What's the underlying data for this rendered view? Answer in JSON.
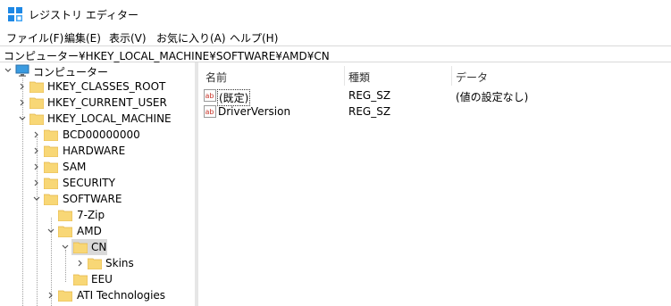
{
  "window": {
    "title": "レジストリ エディター"
  },
  "menu": [
    "ファイル(F)",
    "編集(E)",
    "表示(V)",
    "お気に入り(A)",
    "ヘルプ(H)"
  ],
  "address": "コンピューター¥HKEY_LOCAL_MACHINE¥SOFTWARE¥AMD¥CN",
  "tree": {
    "root": "コンピューター",
    "nodes": [
      {
        "label": "HKEY_CLASSES_ROOT"
      },
      {
        "label": "HKEY_CURRENT_USER"
      },
      {
        "label": "HKEY_LOCAL_MACHINE"
      },
      {
        "label": "BCD00000000"
      },
      {
        "label": "HARDWARE"
      },
      {
        "label": "SAM"
      },
      {
        "label": "SECURITY"
      },
      {
        "label": "SOFTWARE"
      },
      {
        "label": "7-Zip"
      },
      {
        "label": "AMD"
      },
      {
        "label": "CN"
      },
      {
        "label": "Skins"
      },
      {
        "label": "EEU"
      },
      {
        "label": "ATI Technologies"
      }
    ]
  },
  "list": {
    "columns": [
      "名前",
      "種類",
      "データ"
    ],
    "rows": [
      {
        "name": "(既定)",
        "type": "REG_SZ",
        "data": "(値の設定なし)",
        "icon": "string-value-icon"
      },
      {
        "name": "DriverVersion",
        "type": "REG_SZ",
        "data": "",
        "icon": "string-value-icon"
      }
    ]
  },
  "colors": {
    "folder": "#f8d776",
    "folder_dark": "#e3b54a",
    "selection": "#d9d9d9",
    "value_icon_red": "#c8352a"
  }
}
